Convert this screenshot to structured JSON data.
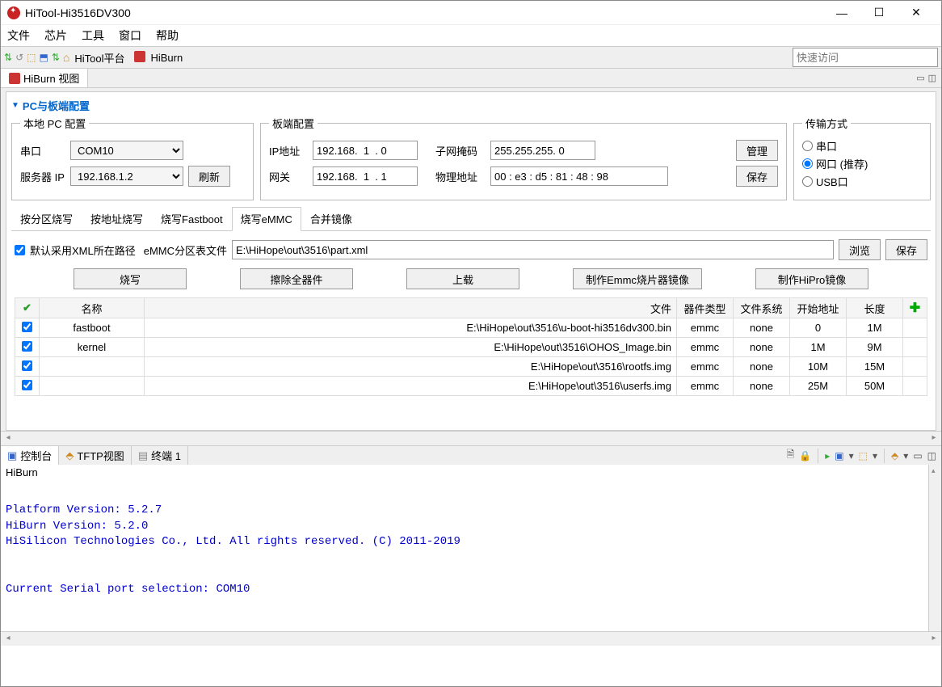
{
  "window": {
    "title": "HiTool-Hi3516DV300"
  },
  "menu": {
    "file": "文件",
    "chip": "芯片",
    "tools": "工具",
    "window": "窗口",
    "help": "帮助"
  },
  "toolbar": {
    "hitool_platform": "HiTool平台",
    "hiburn": "HiBurn",
    "quick_access_placeholder": "快速访问"
  },
  "view_tab": {
    "label": "HiBurn 视图"
  },
  "section": {
    "title": "PC与板端配置"
  },
  "pc_config": {
    "legend": "本地 PC 配置",
    "serial_label": "串口",
    "serial_value": "COM10",
    "server_ip_label": "服务器 IP",
    "server_ip_value": "192.168.1.2",
    "refresh": "刷新"
  },
  "board_config": {
    "legend": "板端配置",
    "ip_label": "IP地址",
    "ip_value": "192.168.  1  . 0",
    "gateway_label": "网关",
    "gateway_value": "192.168.  1  . 1",
    "subnet_label": "子网掩码",
    "subnet_value": "255.255.255. 0",
    "mac_label": "物理地址",
    "mac_value": "00 : e3 : d5 : 81 : 48 : 98",
    "manage": "管理",
    "save": "保存"
  },
  "transfer": {
    "legend": "传输方式",
    "serial": "串口",
    "network": "网口  (推荐)",
    "usb": "USB口"
  },
  "sub_tabs": {
    "by_partition": "按分区烧写",
    "by_address": "按地址烧写",
    "fastboot": "烧写Fastboot",
    "emmc": "烧写eMMC",
    "merge": "合并镜像"
  },
  "emmc_config": {
    "xml_checkbox_label": "默认采用XML所在路径",
    "partition_file_label": "eMMC分区表文件",
    "partition_file_value": "E:\\HiHope\\out\\3516\\part.xml",
    "browse": "浏览",
    "save": "保存"
  },
  "action_buttons": {
    "burn": "烧写",
    "erase_all": "擦除全器件",
    "upload": "上载",
    "make_emmc_image": "制作Emmc烧片器镜像",
    "make_hipro_image": "制作HiPro镜像"
  },
  "table": {
    "headers": {
      "name": "名称",
      "file": "文件",
      "device_type": "器件类型",
      "filesystem": "文件系统",
      "start_addr": "开始地址",
      "length": "长度"
    },
    "rows": [
      {
        "name": "fastboot",
        "file": "E:\\HiHope\\out\\3516\\u-boot-hi3516dv300.bin",
        "device_type": "emmc",
        "filesystem": "none",
        "start": "0",
        "length": "1M"
      },
      {
        "name": "kernel",
        "file": "E:\\HiHope\\out\\3516\\OHOS_Image.bin",
        "device_type": "emmc",
        "filesystem": "none",
        "start": "1M",
        "length": "9M"
      },
      {
        "name": "",
        "file": "E:\\HiHope\\out\\3516\\rootfs.img",
        "device_type": "emmc",
        "filesystem": "none",
        "start": "10M",
        "length": "15M"
      },
      {
        "name": "",
        "file": "E:\\HiHope\\out\\3516\\userfs.img",
        "device_type": "emmc",
        "filesystem": "none",
        "start": "25M",
        "length": "50M"
      }
    ]
  },
  "bottom_tabs": {
    "console": "控制台",
    "tftp": "TFTP视图",
    "terminal": "终端 1"
  },
  "console": {
    "title": "HiBurn",
    "output": "Platform Version: 5.2.7\nHiBurn Version: 5.2.0\nHiSilicon Technologies Co., Ltd. All rights reserved. (C) 2011-2019\n\n\nCurrent Serial port selection: COM10"
  }
}
